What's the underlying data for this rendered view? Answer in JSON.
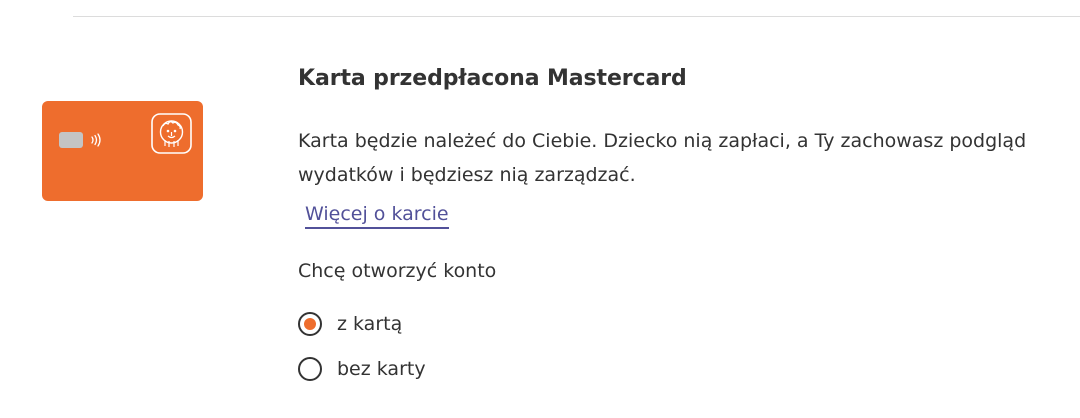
{
  "product": {
    "title": "Karta przedpłacona Mastercard",
    "description_lines": [
      "Karta będzie należeć do Ciebie. Dziecko nią zapłaci, a Ty zachowasz podgląd",
      "wydatków i będziesz nią zarządzać."
    ],
    "more_link": "Więcej o karcie"
  },
  "card_image": {
    "color": "#ee6d2d",
    "chip_color": "#c4c4c4",
    "icons": [
      "chip-icon",
      "contactless-icon",
      "lion-logo-icon"
    ]
  },
  "account_option": {
    "question": "Chcę otworzyć konto",
    "options": [
      {
        "label": "z kartą",
        "selected": true
      },
      {
        "label": "bez karty",
        "selected": false
      }
    ]
  },
  "colors": {
    "accent": "#ee6d2d",
    "link": "#525199",
    "text": "#333333"
  }
}
